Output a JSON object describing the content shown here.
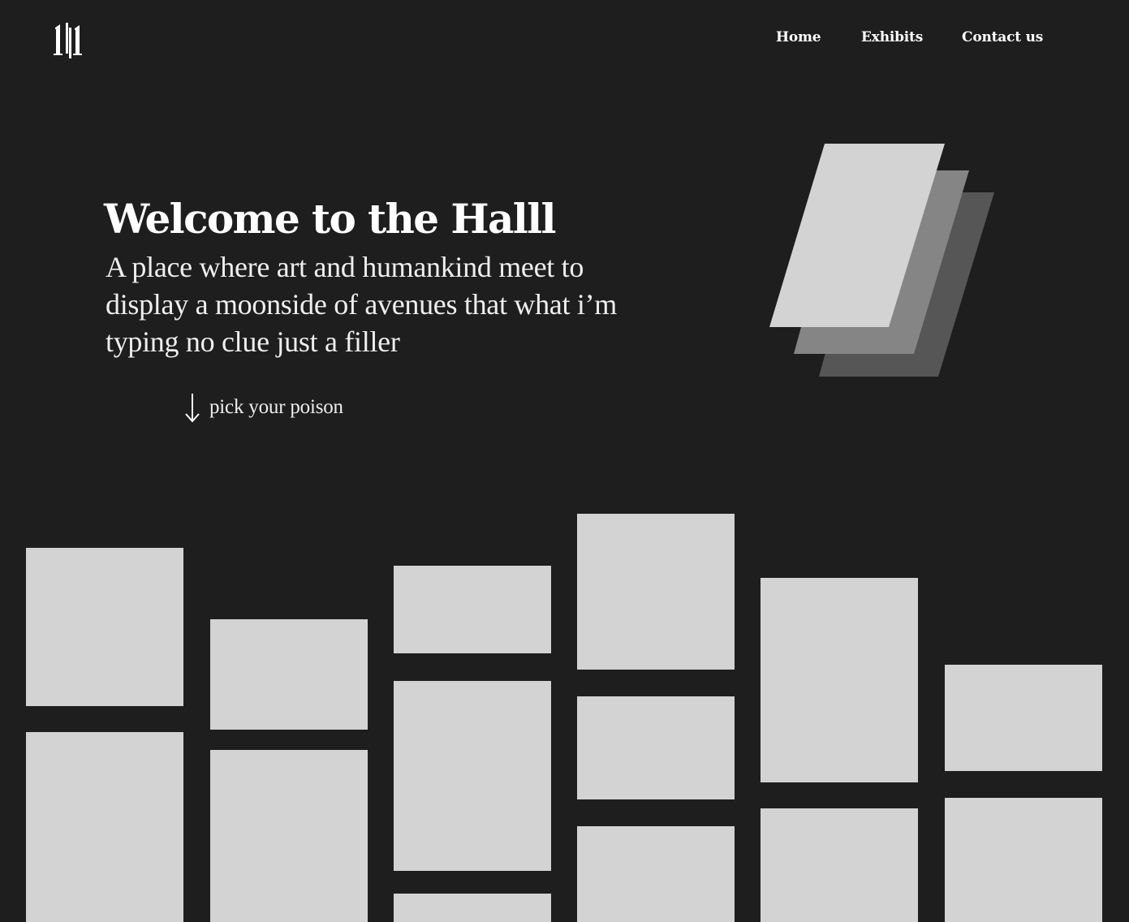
{
  "brand": {
    "logo_icon": "hall-logo-icon"
  },
  "nav": {
    "home": "Home",
    "exhibits": "Exhibits",
    "contact": "Contact us"
  },
  "hero": {
    "title": "Welcome to the Halll",
    "subtitle": "A place where art and humankind meet to display a moonside of avenues that what i’m typing no clue just a filler",
    "cta_label": "pick your poison",
    "cta_icon": "arrow-down-icon",
    "illustration_icon": "stacked-frames-icon"
  },
  "gallery": {
    "columns": 6,
    "tile_count": 13
  },
  "colors": {
    "background": "#1e1e1e",
    "text": "#ffffff",
    "tile": "#d3d3d3",
    "stack_front": "#d3d3d3",
    "stack_middle": "#858585",
    "stack_back": "#565656"
  }
}
